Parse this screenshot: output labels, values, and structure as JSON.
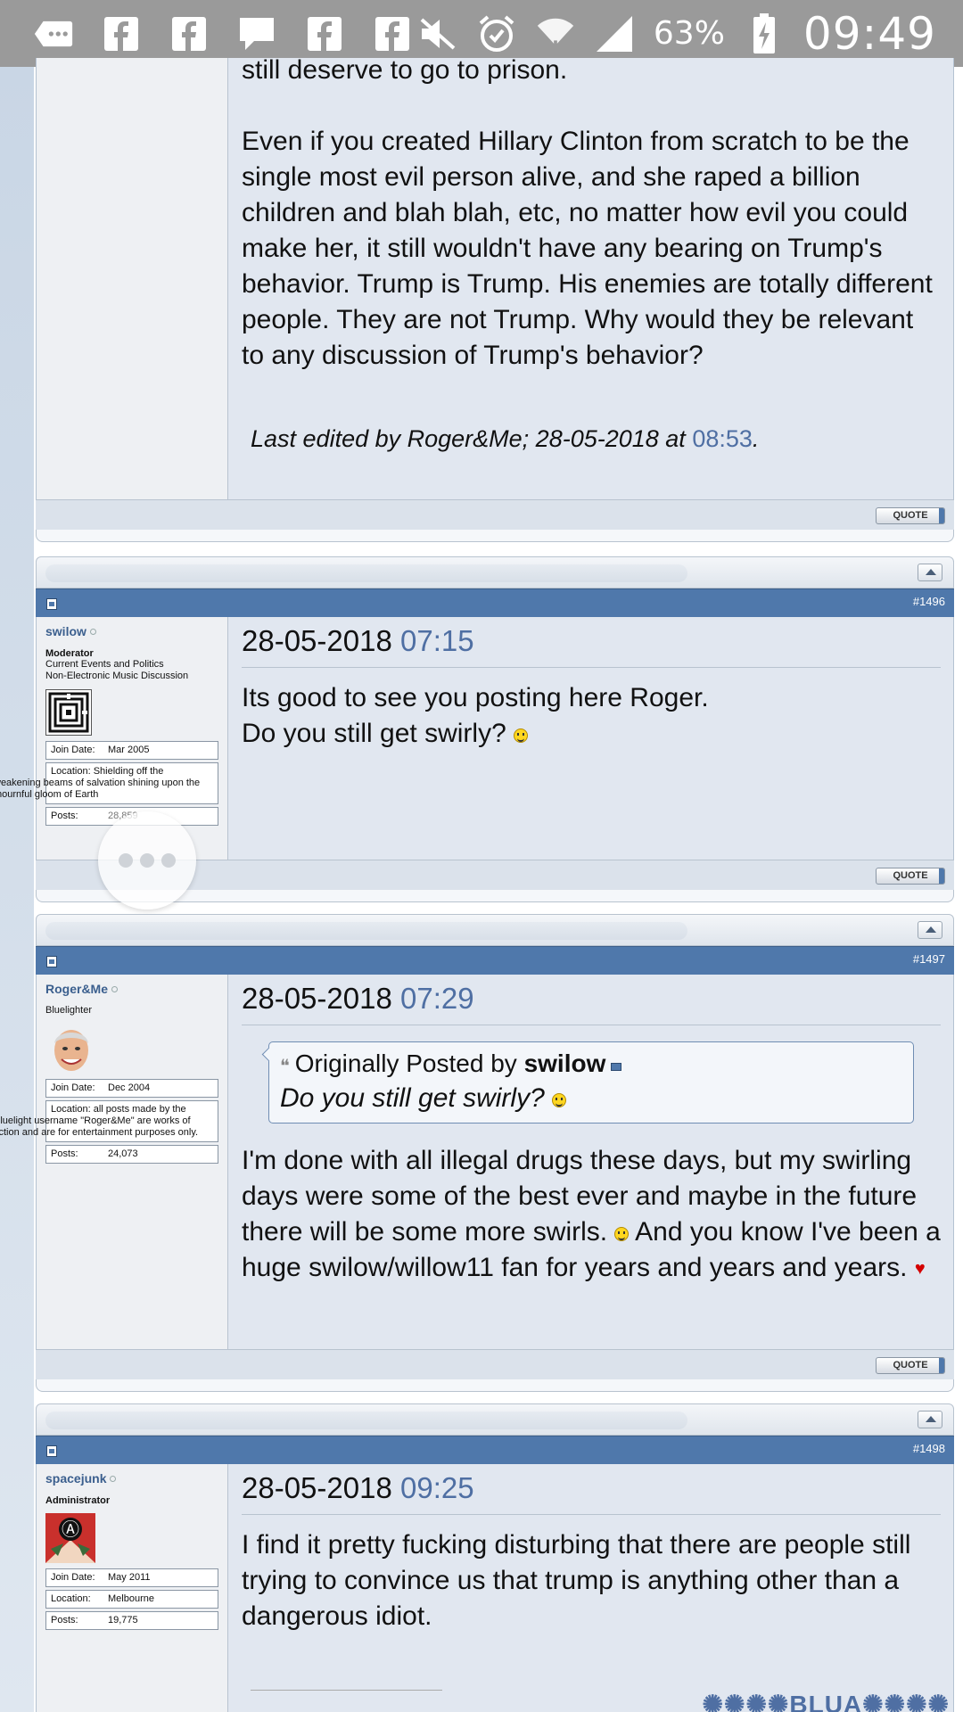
{
  "status_bar": {
    "battery": "63%",
    "time": "09:49"
  },
  "post_prev": {
    "text_top": "still deserve to go to prison.",
    "text_main": "Even if you created Hillary Clinton from scratch to be the single most evil person alive, and she raped a billion children and blah blah, etc, no matter how evil you could make her, it still wouldn't have any bearing on Trump's behavior. Trump is Trump. His enemies are totally different people. They are not Trump. Why would they be relevant to any discussion of Trump's behavior?",
    "last_edited": "Last edited by Roger&Me; 28-05-2018 at ",
    "last_edited_time": "08:53",
    "quote_label": "QUOTE"
  },
  "posts": [
    {
      "number": "#1496",
      "username": "swilow",
      "title": "Moderator",
      "forums": "Current Events and Politics\nNon-Electronic Music Discussion",
      "join_label": "Join Date:",
      "join_date": "Mar 2005",
      "location_label": "Location:",
      "location": "Shielding off the weakening beams of salvation shining upon the mournful gloom of Earth",
      "posts_label": "Posts:",
      "posts_count": "28,859",
      "date": "28-05-2018",
      "time": "07:15",
      "message_line1": "Its good to see you posting here Roger.",
      "message_line2": "Do you still get swirly?",
      "quote_label": "QUOTE"
    },
    {
      "number": "#1497",
      "username": "Roger&Me",
      "title": "Bluelighter",
      "join_label": "Join Date:",
      "join_date": "Dec 2004",
      "location_label": "Location:",
      "location": "all posts made by the Bluelight username \"Roger&Me\" are works of fiction and are for entertainment purposes only.",
      "posts_label": "Posts:",
      "posts_count": "24,073",
      "date": "28-05-2018",
      "time": "07:29",
      "quote_prefix": "Originally Posted by",
      "quote_author": "swilow",
      "quote_text": "Do you still get swirly?",
      "message_a": "I'm done with all illegal drugs these days, but my swirling days were some of the best ever and maybe in the future there will be some more swirls.",
      "message_b": "And you know I've been a huge swilow/willow11 fan for years and years and years.",
      "quote_label": "QUOTE"
    },
    {
      "number": "#1498",
      "username": "spacejunk",
      "title": "Administrator",
      "join_label": "Join Date:",
      "join_date": "May 2011",
      "location_label": "Location:",
      "location": "Melbourne",
      "posts_label": "Posts:",
      "posts_count": "19,775",
      "date": "28-05-2018",
      "time": "09:25",
      "message": "I find it pretty fucking disturbing that there are people still trying to convince us that trump is anything other than a dangerous idiot.",
      "signature": "✺✺✺✺BLUA✺✺✺✺"
    }
  ]
}
